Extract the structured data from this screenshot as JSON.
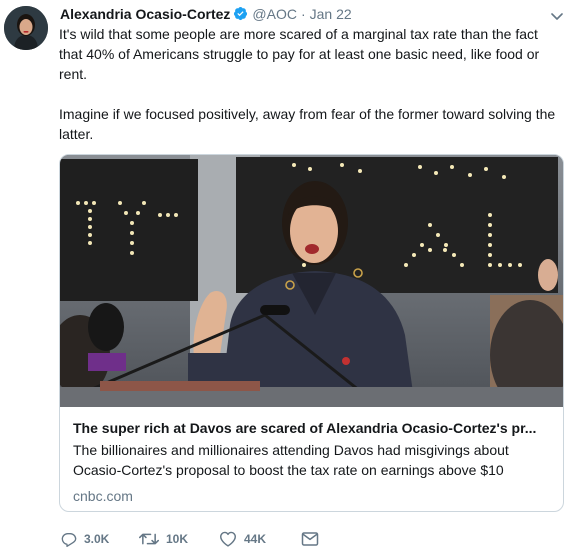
{
  "tweet": {
    "author_name": "Alexandria Ocasio-Cortez",
    "handle": "@AOC",
    "separator": "·",
    "date": "Jan 22",
    "paragraphs": [
      "It's wild that some people are more scared of a marginal tax rate than the fact that 40% of Americans struggle to pay for at least one basic need, like food or rent.",
      "Imagine if we focused positively, away from fear of the former toward solving the latter."
    ]
  },
  "card": {
    "title": "The super rich at Davos are scared of Alexandria Ocasio-Cortez's pr...",
    "description": "The billionaires and millionaires attending Davos had misgivings about Ocasio-Cortez's proposal to boost the tax rate on earnings above $10",
    "domain": "cnbc.com"
  },
  "actions": {
    "replies": "3.0K",
    "retweets": "10K",
    "likes": "44K"
  },
  "icons": [
    "verified-badge-icon",
    "chevron-down-icon",
    "reply-icon",
    "retweet-icon",
    "like-icon",
    "direct-message-icon"
  ],
  "colors": {
    "verified": "#1da1f2",
    "muted": "#657786",
    "text": "#14171a",
    "border": "#ccd6dd"
  }
}
